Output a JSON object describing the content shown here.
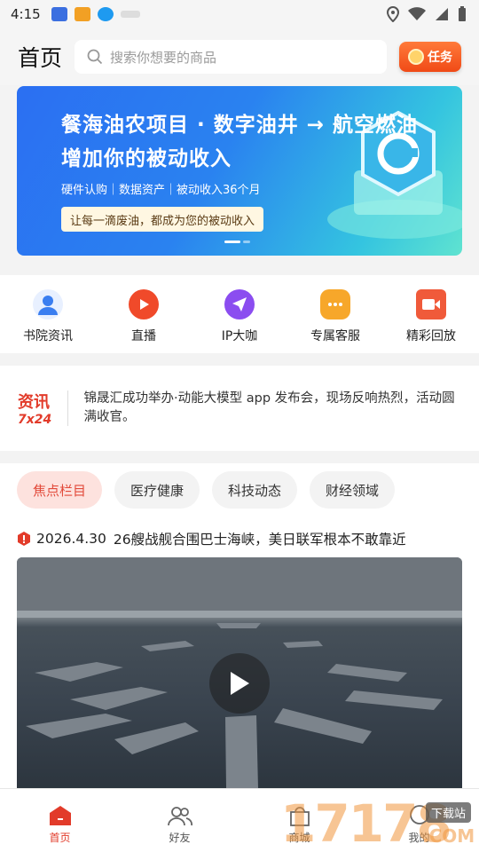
{
  "status_bar": {
    "time": "4:15"
  },
  "header": {
    "title": "首页",
    "search_placeholder": "搜索你想要的商品",
    "task_label": "任务"
  },
  "banner": {
    "line1": "餐海油农项目 · 数字油井 → 航空燃油",
    "line2": "增加你的被动收入",
    "line3": "硬件认购｜数据资产｜被动收入36个月",
    "pill": "让每一滴废油，都成为您的被动收入"
  },
  "quick_nav": [
    {
      "label": "书院资讯",
      "icon": "user-icon",
      "color": "#3a7ef0"
    },
    {
      "label": "直播",
      "icon": "play-icon",
      "color": "#f04a2a"
    },
    {
      "label": "IP大咖",
      "icon": "send-icon",
      "color": "#8b4df0"
    },
    {
      "label": "专属客服",
      "icon": "chat-icon",
      "color": "#f7a72a"
    },
    {
      "label": "精彩回放",
      "icon": "video-icon",
      "color": "#f05a3a"
    }
  ],
  "ticker": {
    "logo_top": "资讯",
    "logo_bottom": "7x24",
    "text": "锦晟汇成功举办·动能大模型 app 发布会，现场反响热烈，活动圆满收官。"
  },
  "tabs": [
    "焦点栏目",
    "医疗健康",
    "科技动态",
    "财经领域"
  ],
  "headline": {
    "date": "2026.4.30",
    "title": "26艘战舰合围巴士海峡，美日联军根本不敢靠近"
  },
  "bottom_nav": [
    {
      "label": "首页"
    },
    {
      "label": "好友"
    },
    {
      "label": "商城"
    },
    {
      "label": "我的"
    }
  ],
  "watermark": {
    "text": "17178",
    "sub": "下载站",
    "suffix": ".COM"
  },
  "colors": {
    "accent": "#e23b2a",
    "tab_active_bg": "#fde2de"
  }
}
